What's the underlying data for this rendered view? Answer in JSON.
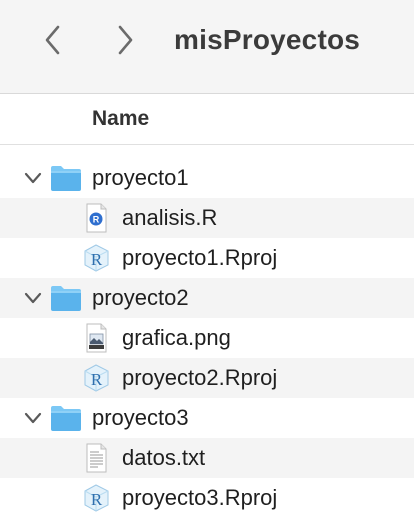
{
  "window": {
    "title": "misProyectos"
  },
  "toolbar": {
    "back_icon": "chevron-left-icon",
    "forward_icon": "chevron-right-icon"
  },
  "header": {
    "name_column": "Name"
  },
  "colors": {
    "folder": "#5ab3ec",
    "folder_tab": "#7cc8f5",
    "alt_row": "#f4f4f4"
  },
  "items": [
    {
      "name": "proyecto1",
      "kind": "folder",
      "icon": "folder-icon",
      "expanded": true
    },
    {
      "name": "analisis.R",
      "kind": "r-script",
      "icon": "r-script-icon"
    },
    {
      "name": "proyecto1.Rproj",
      "kind": "rproj",
      "icon": "rproj-icon"
    },
    {
      "name": "proyecto2",
      "kind": "folder",
      "icon": "folder-icon",
      "expanded": true
    },
    {
      "name": "grafica.png",
      "kind": "image",
      "icon": "image-file-icon"
    },
    {
      "name": "proyecto2.Rproj",
      "kind": "rproj",
      "icon": "rproj-icon"
    },
    {
      "name": "proyecto3",
      "kind": "folder",
      "icon": "folder-icon",
      "expanded": true
    },
    {
      "name": "datos.txt",
      "kind": "text",
      "icon": "text-file-icon"
    },
    {
      "name": "proyecto3.Rproj",
      "kind": "rproj",
      "icon": "rproj-icon"
    }
  ]
}
